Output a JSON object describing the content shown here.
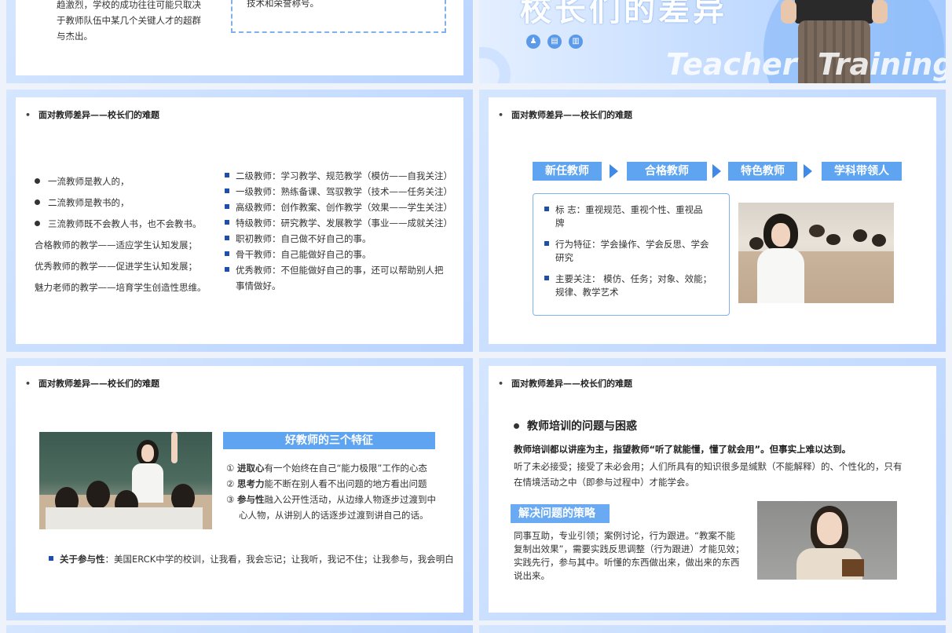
{
  "slide1": {
    "lines": [
      "趋激烈，学校的成功往往可能只取决",
      "于教师队伍中某几个关键人才的超群",
      "与杰出。"
    ],
    "box_text": "技术和荣誉称号。"
  },
  "slide2": {
    "title": "校长们的差异",
    "watermark": "Teacher  Training",
    "icons": [
      "people-icon",
      "clipboard-icon",
      "book-icon"
    ]
  },
  "header": "面对教师差异——校长们的难题",
  "slide3": {
    "left": [
      {
        "bullet": true,
        "text": "一流教师是教人的，"
      },
      {
        "bullet": true,
        "text": "二流教师是教书的，"
      },
      {
        "bullet": true,
        "text": "三流教师既不会教人书，也不会教书。"
      },
      {
        "bullet": false,
        "text": "合格教师的教学——适应学生认知发展；"
      },
      {
        "bullet": false,
        "text": "优秀教师的教学——促进学生认知发展；"
      },
      {
        "bullet": false,
        "text": "魅力老师的教学——培育学生创造性思维。"
      }
    ],
    "right": [
      "二级教师：学习教学、规范教学（模仿——自我关注）",
      "一级教师：熟练备课、驾驭教学（技术——任务关注）",
      "高级教师：创作教案、创作教学（效果——学生关注）",
      "特级教师：研究教学、发展教学（事业——成就关注）",
      "职初教师：自己做不好自己的事。",
      "骨干教师：自己能做好自己的事。",
      "优秀教师：不但能做好自己的事，还可以帮助别人把",
      "事情做好。"
    ]
  },
  "slide4": {
    "steps": [
      "新任教师",
      "合格教师",
      "特色教师",
      "学科带领人"
    ],
    "items": [
      [
        "标  志：重视规范、重视个性、重视品",
        "牌"
      ],
      [
        "行为特征：学会操作、学会反思、学会",
        "研究"
      ],
      [
        "主要关注：  模仿、任务；对象、效能；",
        "规律、教学艺术"
      ]
    ]
  },
  "slide5": {
    "bar_title": "好教师的三个特征",
    "features": [
      {
        "num": "①",
        "bold": "进取心",
        "rest": "有一个始终在自己“能力极限”工作的心态"
      },
      {
        "num": "②",
        "bold": "思考力",
        "rest": "能不断在别人看不出问题的地方看出问题"
      },
      {
        "num": "③",
        "bold": "参与性",
        "rest": "融入公开性活动，从边缘人物逐步过渡到中"
      }
    ],
    "feature_cont": "心人物，从讲别人的话逐步过渡到讲自己的话。",
    "note_bold": "关于参与性",
    "note_rest": "：美国ERCK中学的校训，让我看，我会忘记；让我听，我记不住；让我参与，我会明白"
  },
  "slide6": {
    "subtitle": "教师培训的问题与困惑",
    "bold_line": "教师培训都以讲座为主，指望教师“听了就能懂，懂了就会用”。但事实上难以达到。",
    "para": [
      "听了未必接受；接受了未必会用；人们所具有的知识很多是缄默（不能解释）的、个性化的，只有",
      "在情境活动之中（即参与过程中）才能学会。"
    ],
    "bar": "解决问题的策略",
    "strategy": [
      "同事互助，专业引领；案例讨论，行为跟进。“教案不能",
      "复制出效果”，需要实践反思调整（行为跟进）才能见效；",
      "实践先行，参与其中。听懂的东西做出来，做出来的东西",
      "说出来。"
    ]
  },
  "colors": {
    "accent": "#5ea4f0",
    "dark_blue": "#1f4fa8",
    "frame": "#c4dcff"
  }
}
